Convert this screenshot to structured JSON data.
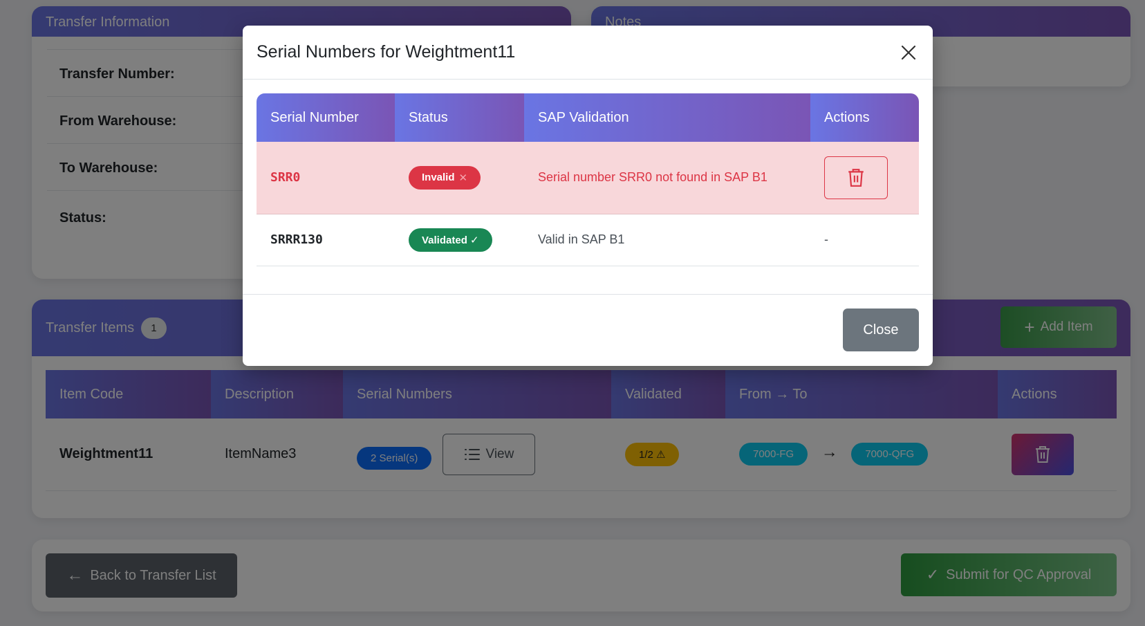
{
  "transfer_info": {
    "title": "Transfer Information",
    "fields": [
      {
        "label": "Transfer Number:"
      },
      {
        "label": "From Warehouse:"
      },
      {
        "label": "To Warehouse:"
      },
      {
        "label": "Status:"
      }
    ]
  },
  "notes": {
    "title": "Notes"
  },
  "transfer_items": {
    "title": "Transfer Items",
    "count": "1",
    "add_label": "Add Item",
    "columns": [
      "Item Code",
      "Description",
      "Serial Numbers",
      "Validated",
      "From → To",
      "Actions"
    ],
    "rows": [
      {
        "item_code": "Weightment11",
        "description": "ItemName3",
        "serials": "2 Serial(s)",
        "view_label": "View",
        "validated": "1/2 ⚠",
        "from": "7000-FG",
        "to": "7000-QFG"
      }
    ]
  },
  "footer": {
    "back_label": "Back to Transfer List",
    "submit_label": "Submit for QC Approval"
  },
  "modal": {
    "title": "Serial Numbers for Weightment11",
    "columns": [
      "Serial Number",
      "Status",
      "SAP Validation",
      "Actions"
    ],
    "rows": [
      {
        "serial": "SRR0",
        "status": "Invalid",
        "status_icon": "✕",
        "validation": "Serial number SRR0 not found in SAP B1"
      },
      {
        "serial": "SRRR130",
        "status": "Validated ✓",
        "validation": "Valid in SAP B1",
        "action": "-"
      }
    ],
    "close_label": "Close"
  },
  "colors": {
    "header_gradient_start": "#6a75e3",
    "header_gradient_end": "#7a55b5",
    "danger": "#dc3545",
    "success": "#198754",
    "secondary": "#6c757d"
  }
}
